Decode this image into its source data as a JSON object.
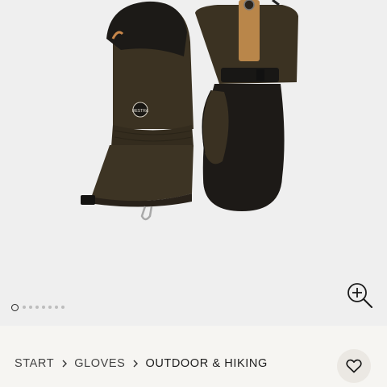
{
  "gallery": {
    "image_count": 8,
    "active_index": 0,
    "zoom_icon": "zoom-in-icon",
    "product_brand_mark": "HESTRA"
  },
  "breadcrumb": {
    "items": [
      {
        "label": "START"
      },
      {
        "label": "GLOVES"
      },
      {
        "label": "OUTDOOR & HIKING"
      }
    ],
    "separator_icon": "chevron-right-icon"
  },
  "wishlist": {
    "icon": "heart-icon"
  },
  "colors": {
    "gallery_bg": "#efefef",
    "info_bg": "#f6f5f2",
    "mitten_shell": "#3d3424",
    "mitten_leather": "#1c1917",
    "tab_tan": "#b9864a"
  }
}
